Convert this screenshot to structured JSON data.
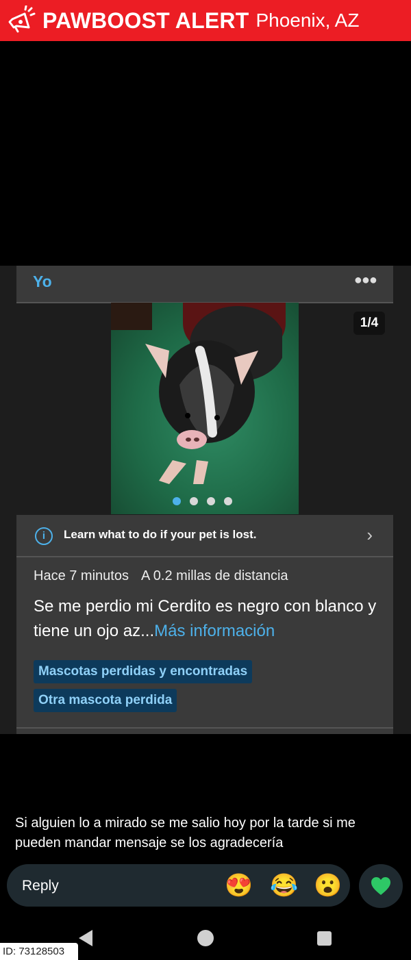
{
  "banner": {
    "brand": "PAWBOOST ALERT",
    "location": "Phoenix, AZ",
    "logo_icon": "megaphone-paw-icon",
    "color": "#ec1d24"
  },
  "post": {
    "author": "Yo",
    "more_icon": "more-dots-icon",
    "photo_counter": "1/4",
    "photo_dots": 4,
    "photo_active": 0,
    "learn_text": "Learn what to do if your pet is lost.",
    "time": "Hace 7 minutos",
    "distance": "A 0.2 millas de distancia",
    "description": "Se me perdio mi Cerdito es  negro con blanco y  tiene un ojo az...",
    "more_link": "Más información",
    "tags": [
      "Mascotas perdidas y encontradas",
      "Otra mascota perdida"
    ]
  },
  "message": "Si alguien lo a mirado se me salio hoy por la tarde si me pueden mandar mensaje se los agradecería",
  "reply": {
    "placeholder": "Reply",
    "emojis": [
      "😍",
      "😂",
      "😮"
    ],
    "like_icon": "heart-icon"
  },
  "footer": {
    "id_label": "ID: 73128503"
  },
  "colors": {
    "accent": "#4db1ea",
    "tag_bg": "#0d3a5b",
    "heart": "#2ec866"
  }
}
